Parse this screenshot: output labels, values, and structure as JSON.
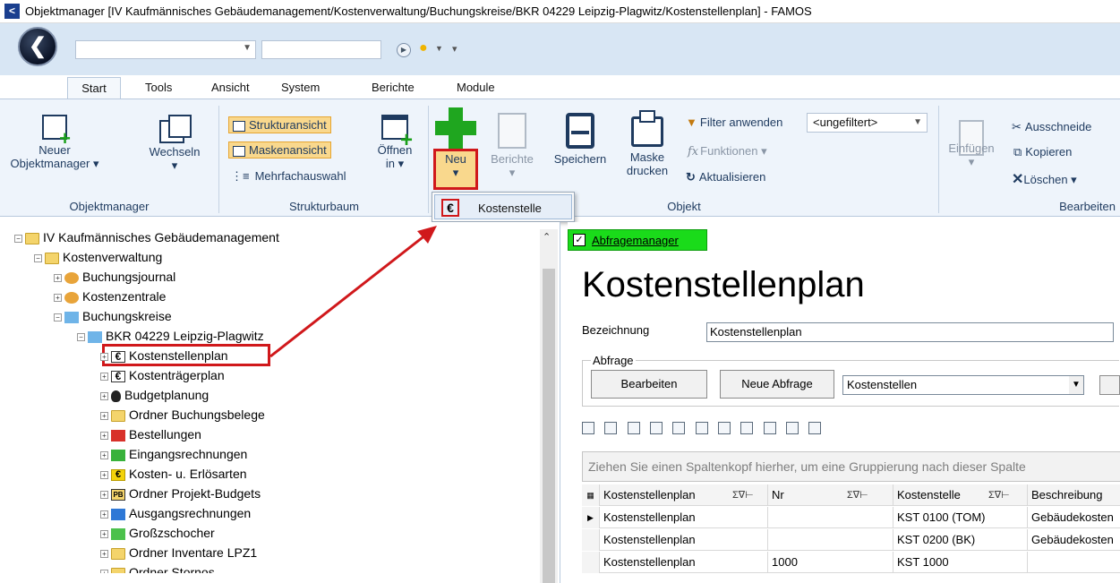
{
  "window": {
    "title": "Objektmanager [IV Kaufmännisches Gebäudemanagement/Kostenverwaltung/Buchungskreise/BKR 04229 Leipzig-Plagwitz/Kostenstellenplan] - FAMOS"
  },
  "ribbon_tabs": [
    "Start",
    "Tools",
    "Ansicht",
    "System",
    "Berichte",
    "Module"
  ],
  "ribbon": {
    "objektmanager": {
      "label": "Objektmanager",
      "neuer_line1": "Neuer",
      "neuer_line2": "Objektmanager ▾",
      "wechseln": "Wechseln",
      "wechseln_dd": "▾"
    },
    "strukturbaum": {
      "label": "Strukturbaum",
      "strukturansicht": "Strukturansicht",
      "maskenansicht": "Maskenansicht",
      "mehrfachauswahl": "Mehrfachauswahl",
      "oeffnen_line1": "Öffnen",
      "oeffnen_line2": "in ▾"
    },
    "objekt": {
      "label": "Objekt",
      "neu": "Neu",
      "neu_dd": "▾",
      "berichte": "Berichte",
      "berichte_dd": "▾",
      "speichern": "Speichern",
      "maske_line1": "Maske",
      "maske_line2": "drucken",
      "filter_anwenden": "Filter anwenden",
      "filter_value": "<ungefiltert>",
      "funktionen": "Funktionen",
      "aktualisieren": "Aktualisieren"
    },
    "bearbeiten": {
      "label": "Bearbeiten",
      "einfuegen": "Einfügen",
      "einfuegen_dd": "▾",
      "ausschneiden": "Ausschneide",
      "kopieren": "Kopieren",
      "loeschen": "Löschen ▾"
    }
  },
  "neu_menu": {
    "items": [
      {
        "label": "Kostenstelle",
        "icon": "euro-icon"
      }
    ]
  },
  "tree": {
    "nodes": [
      {
        "label": "IV Kaufmännisches Gebäudemanagement",
        "icon": "folder"
      },
      {
        "label": "Kostenverwaltung",
        "icon": "folder-open"
      },
      {
        "label": "Buchungsjournal",
        "icon": "journal"
      },
      {
        "label": "Kostenzentrale",
        "icon": "journal"
      },
      {
        "label": "Buchungskreise",
        "icon": "tree"
      },
      {
        "label": "BKR 04229 Leipzig-Plagwitz",
        "icon": "tree"
      },
      {
        "label": "Kostenstellenplan",
        "icon": "euro"
      },
      {
        "label": "Kostenträgerplan",
        "icon": "euro"
      },
      {
        "label": "Budgetplanung",
        "icon": "bag"
      },
      {
        "label": "Ordner Buchungsbelege",
        "icon": "folder"
      },
      {
        "label": "Bestellungen",
        "icon": "red"
      },
      {
        "label": "Eingangsrechnungen",
        "icon": "green"
      },
      {
        "label": "Kosten- u. Erlösarten",
        "icon": "yellow-euro"
      },
      {
        "label": "Ordner Projekt-Budgets",
        "icon": "pb"
      },
      {
        "label": "Ausgangsrechnungen",
        "icon": "blue"
      },
      {
        "label": "Großzschocher",
        "icon": "leaf"
      },
      {
        "label": "Ordner Inventare LPZ1",
        "icon": "folder"
      },
      {
        "label": "Ordner Stornos",
        "icon": "folder"
      }
    ]
  },
  "right": {
    "abfragemanager_label": "Abfragemanager",
    "page_title": "Kostenstellenplan",
    "bezeichnung_label": "Bezeichnung",
    "bezeichnung_value": "Kostenstellenplan",
    "abfrage_legend": "Abfrage",
    "bearbeiten_btn": "Bearbeiten",
    "neue_abfrage_btn": "Neue Abfrage",
    "abfrage_value": "Kostenstellen",
    "group_hint": "Ziehen Sie einen Spaltenkopf hierher, um eine Gruppierung nach dieser Spalte",
    "grid": {
      "headers": [
        "Kostenstellenplan",
        "Nr",
        "Kostenstelle",
        "Beschreibung"
      ],
      "rows": [
        [
          "Kostenstellenplan",
          "",
          "KST 0100 (TOM)",
          "Gebäudekosten"
        ],
        [
          "Kostenstellenplan",
          "",
          "KST 0200 (BK)",
          "Gebäudekosten"
        ],
        [
          "Kostenstellenplan",
          "1000",
          "KST 1000",
          ""
        ]
      ]
    }
  },
  "colors": {
    "annotation_red": "#d0181b",
    "ribbon_bg": "#eef4fb",
    "abfragemanager_green": "#1adb1a",
    "toggle_orange": "#f9d88d"
  }
}
